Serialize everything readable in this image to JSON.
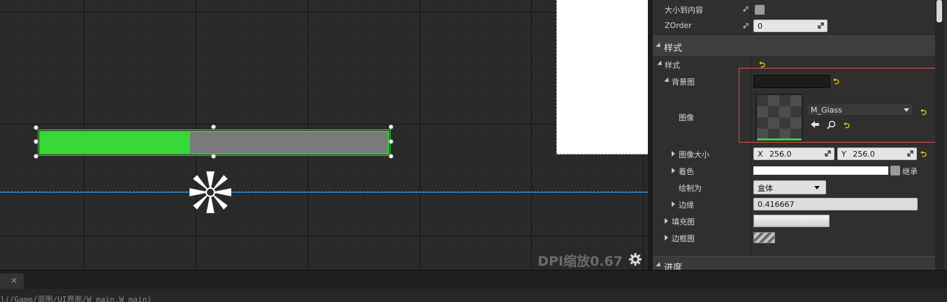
{
  "canvas": {
    "dpi_label": "DPI缩放0.67",
    "progress": {
      "percent": 0.43,
      "fill_color": "#38d838",
      "background_color": "#7a7a7a"
    }
  },
  "details": {
    "rows": {
      "size_to_content": {
        "label": "大小到内容",
        "checked": false
      },
      "zorder": {
        "label": "ZOrder",
        "value": "0"
      },
      "style_category": {
        "label": "样式"
      },
      "style_group": {
        "label": "样式"
      },
      "background_image": {
        "label": "背景图"
      },
      "image": {
        "label": "图像",
        "asset": "M_Glass"
      },
      "image_size": {
        "label": "图像大小",
        "x_prefix": "X",
        "x": "256.0",
        "y_prefix": "Y",
        "y": "256.0"
      },
      "tint": {
        "label": "着色",
        "inherit_label": "继承"
      },
      "draw_as": {
        "label": "绘制为",
        "value": "盒体"
      },
      "margin": {
        "label": "边缘",
        "value": "0.416667"
      },
      "fill_image": {
        "label": "填充图"
      },
      "border_image": {
        "label": "边框图"
      },
      "progress_category": {
        "label": "进度"
      }
    },
    "highlight_color": "#d9534f",
    "reset_color": "#f5d000"
  },
  "bottom": {
    "tab_close": "×",
    "path": "al(/Game/蓝图/UI界面/W_main.W_main)"
  }
}
